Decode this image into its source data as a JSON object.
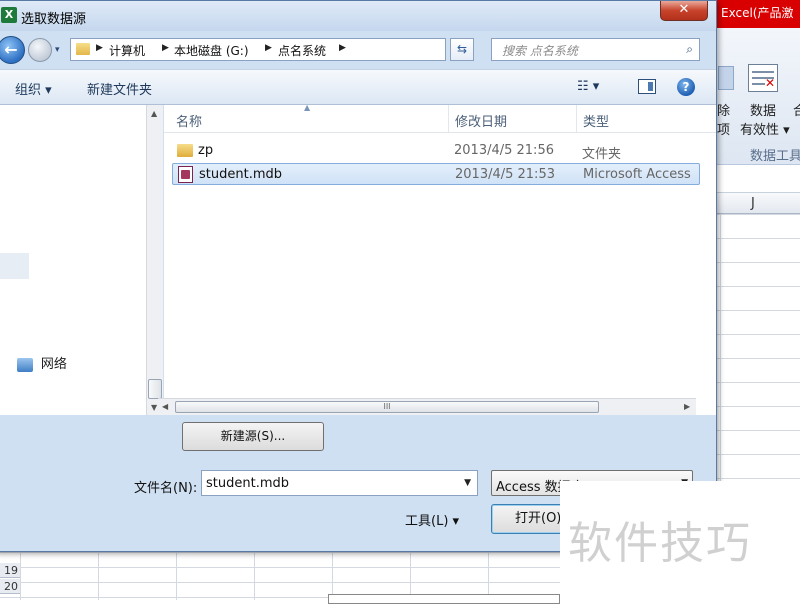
{
  "dialog": {
    "title": "选取数据源",
    "close_label": "✕",
    "app_icon_glyph": "X"
  },
  "nav": {
    "back_glyph": "←",
    "dropdown_glyph": "▾",
    "breadcrumbs": [
      "计算机",
      "本地磁盘 (G:)",
      "点名系统"
    ],
    "address_dropdown_glyph": "▾",
    "refresh_glyph": "⇆",
    "search_placeholder": "搜索 点名系统",
    "search_glyph": "⌕"
  },
  "toolbar": {
    "organize_label": "组织 ▾",
    "new_folder_label": "新建文件夹",
    "view_label": "☷ ▾",
    "help_label": "?"
  },
  "nav_pane": {
    "network_label": "网络"
  },
  "file_list": {
    "columns": {
      "name": "名称",
      "date": "修改日期",
      "type": "类型"
    },
    "rows": [
      {
        "icon": "folder-icon",
        "name": "zp",
        "date": "2013/4/5 21:56",
        "type": "文件夹",
        "selected": false
      },
      {
        "icon": "access-db-icon",
        "name": "student.mdb",
        "date": "2013/4/5 21:53",
        "type": "Microsoft Access",
        "selected": true
      }
    ],
    "hscroll_grip": "III"
  },
  "bottom": {
    "new_source_label": "新建源(S)...",
    "filename_label": "文件名(N):",
    "filename_value": "student.mdb",
    "filetype_value": "Access 数据库 (*.mdb;*.mde;",
    "tools_label": "工具(L)   ▾",
    "open_label": "打开(O)"
  },
  "excel": {
    "title_fragment": "Excel(产品激",
    "ribbon_left_text_1": "除",
    "ribbon_left_text_2": "项",
    "ribbon_data_label_1": "数据",
    "ribbon_data_label_2": "有效性 ▾",
    "ribbon_group_label": "数据工具",
    "ribbon_right_text_1": "合",
    "ribbon_right_text_2": "",
    "ribbon_icon_mark": "✕",
    "column_j": "J",
    "row_numbers": [
      "19",
      "20"
    ]
  },
  "watermark": {
    "text": "软件技巧"
  },
  "colors": {
    "excel_title_red": "#d80000",
    "dialog_frame": "#cfe0f3",
    "selection_blue": "#cfe2f7",
    "close_red": "#c7432c"
  }
}
